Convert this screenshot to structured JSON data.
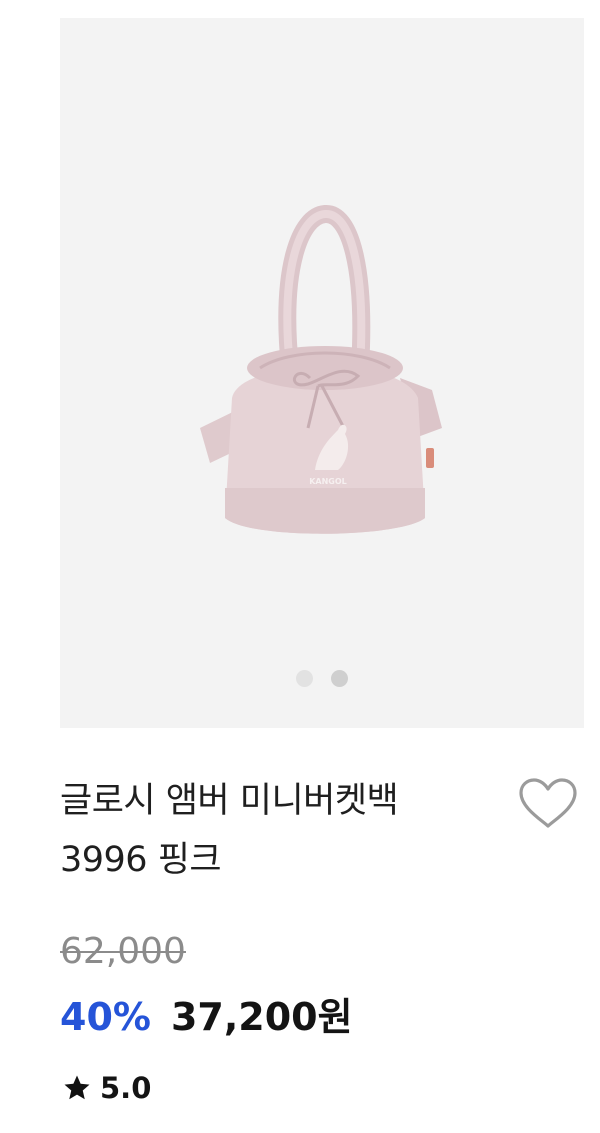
{
  "gallery": {
    "image_label": "KANGOL",
    "slide_count": 2,
    "active_slide": 2
  },
  "product": {
    "name_line1": "글로시 앰버 미니버켓백",
    "name_line2": "3996 핑크",
    "original_price": "62,000",
    "discount": "40%",
    "sale_price": "37,200원",
    "rating": "5.0"
  },
  "icons": {
    "wish": "heart-outline-icon",
    "rating": "star-icon"
  },
  "colors": {
    "discount": "#2554d8",
    "bag": "#e3cfd2",
    "image_background": "#f3f3f3"
  }
}
